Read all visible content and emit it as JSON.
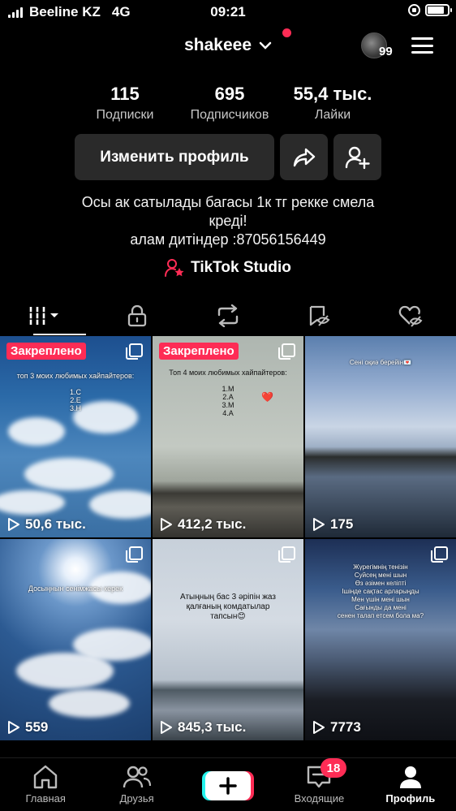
{
  "status_bar": {
    "carrier": "Beeline KZ",
    "network": "4G",
    "time": "09:21"
  },
  "header": {
    "username": "shakeee",
    "avatar_count": "99"
  },
  "stats": [
    {
      "value": "115",
      "label": "Подписки"
    },
    {
      "value": "695",
      "label": "Подписчиков"
    },
    {
      "value": "55,4 тыс.",
      "label": "Лайки"
    }
  ],
  "actions": {
    "edit_profile": "Изменить профиль"
  },
  "bio": {
    "line1": "Осы ак сатылады багасы 1к  тг рекке смела",
    "line2": "креді!",
    "line3": "алам дитіндер :87056156449"
  },
  "studio_link": "TikTok Studio",
  "videos": [
    {
      "views": "50,6 тыс.",
      "pinned_label": "Закреплено",
      "caption": "топ 3 моих любимых хайпайтеров:\n\n1.С\n2.Е\n3.Н"
    },
    {
      "views": "412,2 тыс.",
      "pinned_label": "Закреплено",
      "caption": "Топ 4 моих любимых хайпайтеров:\n\n1.М\n2.А\n3.М\n4.А"
    },
    {
      "views": "175",
      "caption": "Сені оқиә берейін💌"
    },
    {
      "views": "559",
      "caption": "Досыңнын сенімжасы керек"
    },
    {
      "views": "845,3 тыс.",
      "caption": "Атыңның бас 3 әріпін жаз қалғаның комдатылар тапсын😊"
    },
    {
      "views": "7773",
      "caption": "Жүрегімнің тенізін\nСуйсең мені шын\nӨз әзімен келіпті\nІшінде сақтас арларыңды\nМен үшін мені шын\nСағынды да мені\nсенен талап етсем бола ма?"
    }
  ],
  "bottom_nav": [
    {
      "label": "Главная",
      "icon": "home-icon"
    },
    {
      "label": "Друзья",
      "icon": "friends-icon"
    },
    {
      "label": "",
      "icon": "plus-icon"
    },
    {
      "label": "Входящие",
      "icon": "inbox-icon"
    },
    {
      "label": "Профиль",
      "icon": "profile-icon"
    }
  ],
  "inbox_badge": "18",
  "colors": {
    "accent": "#fe2c55",
    "cyan": "#25f4ee",
    "button_bg": "#2a2a2a"
  }
}
